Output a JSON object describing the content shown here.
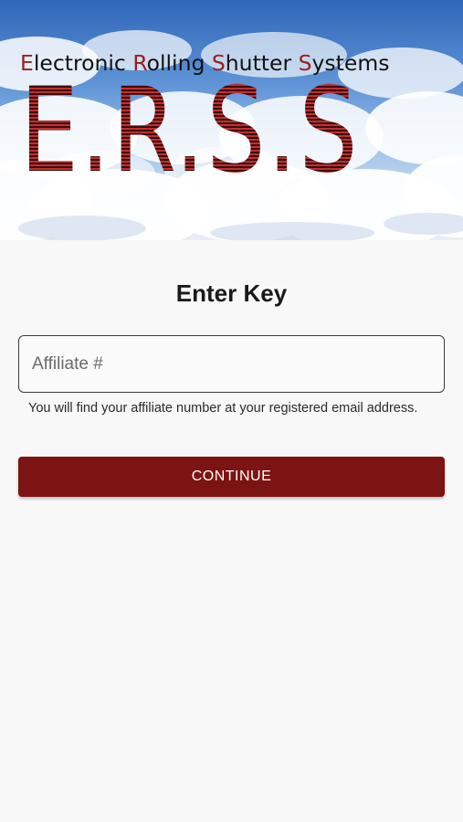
{
  "banner": {
    "subtitle_words": [
      {
        "cap": "E",
        "rest": "lectronic "
      },
      {
        "cap": "R",
        "rest": "olling "
      },
      {
        "cap": "S",
        "rest": "hutter "
      },
      {
        "cap": "S",
        "rest": "ystems"
      }
    ],
    "logo_text": "E.R.S.S.",
    "accent_color": "#b22a2a"
  },
  "form": {
    "title": "Enter Key",
    "affiliate_placeholder": "Affiliate #",
    "affiliate_value": "",
    "helper_text": "You will find your affiliate number at your registered email address.",
    "continue_label": "CONTINUE",
    "button_color": "#7b1412"
  }
}
